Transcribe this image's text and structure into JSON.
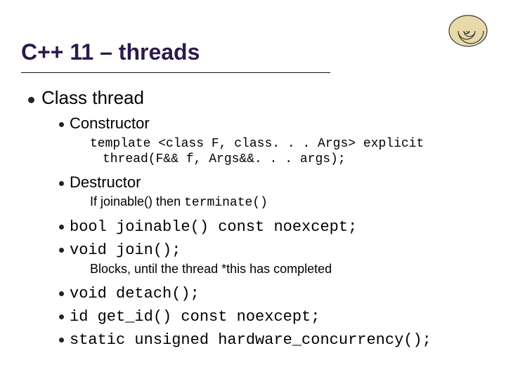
{
  "title": "C++ 11 – threads",
  "spiral_name": "spiral-shell-icon",
  "lvl1": {
    "label": "Class thread"
  },
  "constructor": {
    "label": "Constructor",
    "sig": "template <class F, class. . . Args> explicit thread(F&& f, Args&&. . . args);"
  },
  "destructor": {
    "label": "Destructor",
    "note_prefix": "If joinable() then ",
    "note_code": "terminate()"
  },
  "joinable": "bool joinable() const noexcept;",
  "join": {
    "sig": "void join();",
    "note": "Blocks, until the thread *this has completed"
  },
  "detach": "void detach();",
  "getid": "id get_id() const noexcept;",
  "hwconc": "static unsigned hardware_concurrency();"
}
